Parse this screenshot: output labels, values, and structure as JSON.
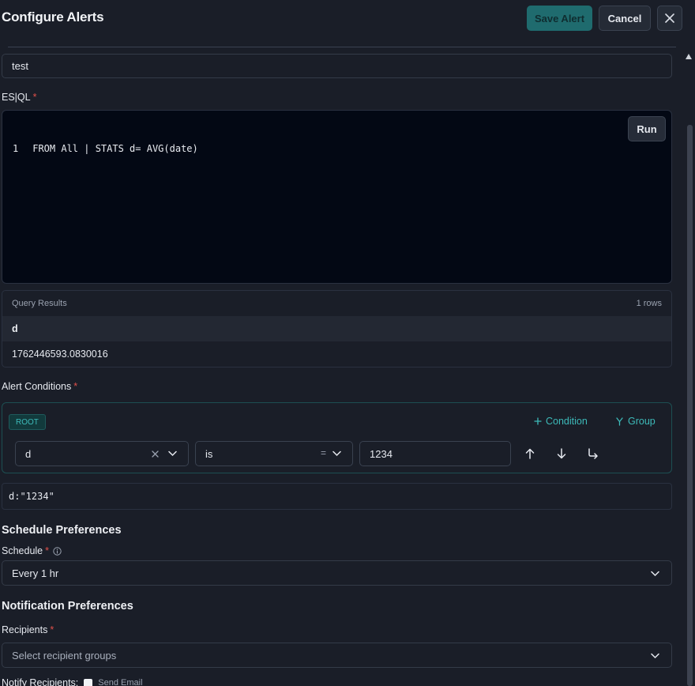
{
  "header": {
    "title": "Configure Alerts",
    "save_label": "Save Alert",
    "cancel_label": "Cancel",
    "close_icon": "close-icon"
  },
  "name_field": {
    "value": "test"
  },
  "esql": {
    "label": "ES|QL",
    "required_mark": "*",
    "run_label": "Run",
    "line_number": "1",
    "code": "FROM All | STATS d= AVG(date)"
  },
  "query_results": {
    "title": "Query Results",
    "row_count": "1 rows",
    "column": "d",
    "value": "1762446593.0830016"
  },
  "alert_conditions": {
    "label": "Alert Conditions",
    "required_mark": "*",
    "root_badge": "ROOT",
    "add_condition_label": "Condition",
    "add_group_label": "Group",
    "field_value": "d",
    "operator_value": "is",
    "operator_symbol": "=",
    "compare_value": "1234"
  },
  "query_preview": "d:\"1234\"",
  "schedule": {
    "section_title": "Schedule Preferences",
    "label": "Schedule",
    "required_mark": "*",
    "value": "Every 1 hr"
  },
  "notification": {
    "section_title": "Notification Preferences",
    "recipients_label": "Recipients",
    "required_mark": "*",
    "recipients_placeholder": "Select recipient groups",
    "notify_label": "Notify Recipients:",
    "send_email_label": "Send Email"
  },
  "colors": {
    "accent": "#3dbab9",
    "background": "#1a1e28",
    "editor_bg": "#030814",
    "required": "#e0504a"
  }
}
